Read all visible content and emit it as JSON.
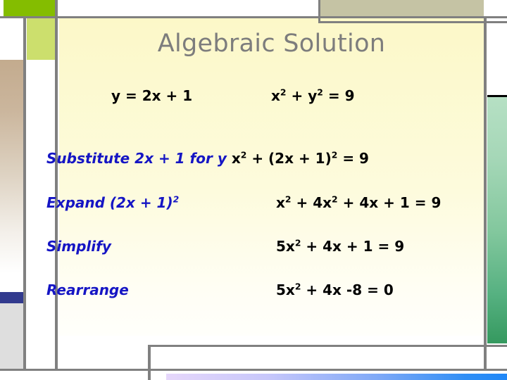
{
  "slide": {
    "title": "Algebraic Solution",
    "background_cream": "#fcf8c8",
    "title_color": "#7d7d7d",
    "label_color": "#1515c4",
    "math_color": "#000000"
  },
  "decorations": {
    "green_bar_color": "#84bd00",
    "green_square_color": "#ccdf6d",
    "khaki_rect_color": "#c5c3a4",
    "navy_block_color": "#323a8e",
    "tan_gradient_top": "#c3ab8e",
    "tan_gradient_bottom": "#ffffff",
    "green_column_top": "#b6e0c4",
    "green_column_bottom": "#35995f",
    "blue_strip_left": "#e6d7fb",
    "blue_strip_right": "#1f87f7",
    "rule_color": "#808080"
  },
  "given": {
    "equation_1": "y = 2x + 1",
    "equation_2_base": "x",
    "equation_2_sup": "2",
    "equation_2_mid": " + y",
    "equation_2_sup2": "2",
    "equation_2_tail": " = 9"
  },
  "steps": [
    {
      "label": "Substitute 2x + 1 for y",
      "result_parts": [
        {
          "t": "x"
        },
        {
          "sup": "2"
        },
        {
          "t": " + (2x + 1)"
        },
        {
          "sup": "2"
        },
        {
          "t": " = 9"
        }
      ],
      "result_plain": "x2 + (2x + 1)2 = 9"
    },
    {
      "label_parts": [
        {
          "t": "Expand (2x + 1)"
        },
        {
          "sup": "2"
        }
      ],
      "label_plain": "Expand (2x + 1)2",
      "result_parts": [
        {
          "t": "x"
        },
        {
          "sup": "2"
        },
        {
          "t": " + 4x"
        },
        {
          "sup": "2"
        },
        {
          "t": " + 4x + 1 = 9"
        }
      ],
      "result_plain": "x2 + 4x2 + 4x + 1 = 9"
    },
    {
      "label": "Simplify",
      "result_parts": [
        {
          "t": "5x"
        },
        {
          "sup": "2"
        },
        {
          "t": " + 4x + 1 = 9"
        }
      ],
      "result_plain": "5x2 + 4x + 1 = 9"
    },
    {
      "label": "Rearrange",
      "result_parts": [
        {
          "t": "5x"
        },
        {
          "sup": "2"
        },
        {
          "t": " + 4x -8 = 0"
        }
      ],
      "result_plain": "5x2 + 4x -8 = 0"
    }
  ],
  "text_fragments": {
    "substitute_label": "Substitute 2x + 1 for y",
    "expand_label_base": "Expand (2x + 1)",
    "expand_label_sup": "2",
    "simplify_label": "Simplify",
    "rearrange_label": "Rearrange",
    "sup_two": "2",
    "x_char": "x",
    "five_x": "5x",
    "substitute_result_a": "x",
    "substitute_result_b": " + (2x + 1)",
    "substitute_result_c": " = 9",
    "expand_result_a": "x",
    "expand_result_b": " + 4x",
    "expand_result_c": " + 4x + 1 = 9",
    "simplify_result_a": "5x",
    "simplify_result_b": " + 4x + 1 = 9",
    "rearrange_result_a": "5x",
    "rearrange_result_b": " + 4x -8 = 0",
    "given_eq1": "y = 2x + 1",
    "given_eq2_a": "x",
    "given_eq2_b": " + y",
    "given_eq2_c": " = 9"
  }
}
